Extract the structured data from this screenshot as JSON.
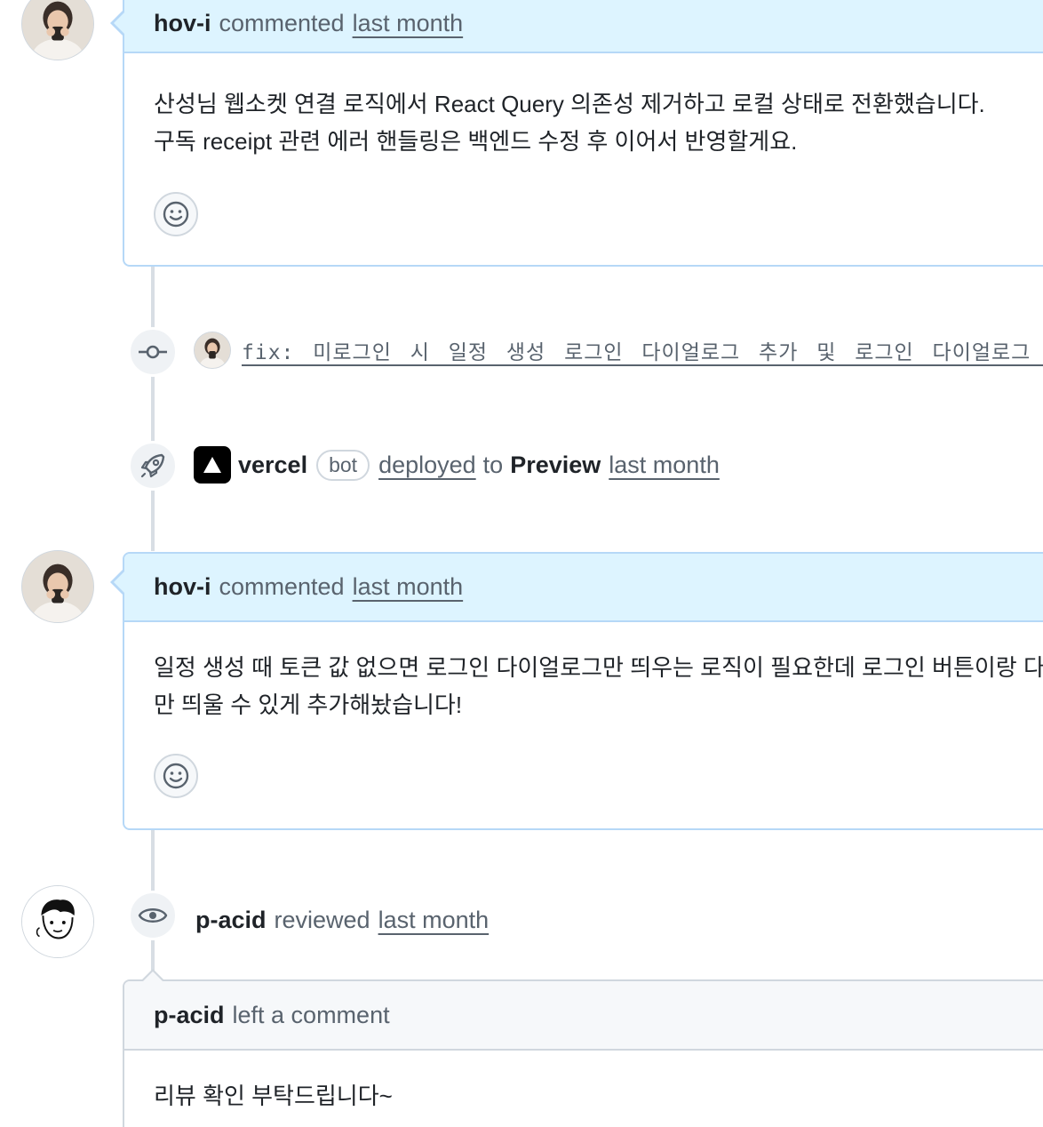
{
  "comments": [
    {
      "author": "hov-i",
      "action": "commented",
      "time": "last month",
      "lines": [
        "산성님 웹소켓 연결 로직에서 React Query 의존성 제거하고 로컬 상태로 전환했습니다.",
        "구독 receipt 관련 에러 핸들링은 백엔드 수정 후 이어서 반영할게요."
      ],
      "emoji_icon": "smiley-icon"
    },
    {
      "author": "hov-i",
      "action": "commented",
      "time": "last month",
      "lines": [
        "일정 생성 때 토큰 값 없으면 로그인 다이얼로그만 띄우는 로직이 필요한데 로그인 버튼이랑 다",
        "만 띄울 수 있게 추가해놨습니다!"
      ],
      "emoji_icon": "smiley-icon"
    }
  ],
  "commit_event": {
    "icon": "git-commit-icon",
    "message": "fix: 미로그인 시 일정 생성 로그인 다이얼로그 추가 및 로그인 다이얼로그 로직 수정"
  },
  "deploy_event": {
    "icon": "rocket-icon",
    "actor": "vercel",
    "bot_label": "bot",
    "action": "deployed",
    "to_word": "to",
    "environment": "Preview",
    "time": "last month"
  },
  "review_event": {
    "icon": "eye-icon",
    "author": "p-acid",
    "action": "reviewed",
    "time": "last month"
  },
  "review_comment": {
    "author": "p-acid",
    "action": "left a comment",
    "body": "리뷰 확인 부탁드립니다~"
  },
  "colors": {
    "header_blue": "#ddf4ff",
    "border_blue": "#b6d8f7",
    "muted_text": "#59636e",
    "timeline_line": "#d8dee4"
  }
}
